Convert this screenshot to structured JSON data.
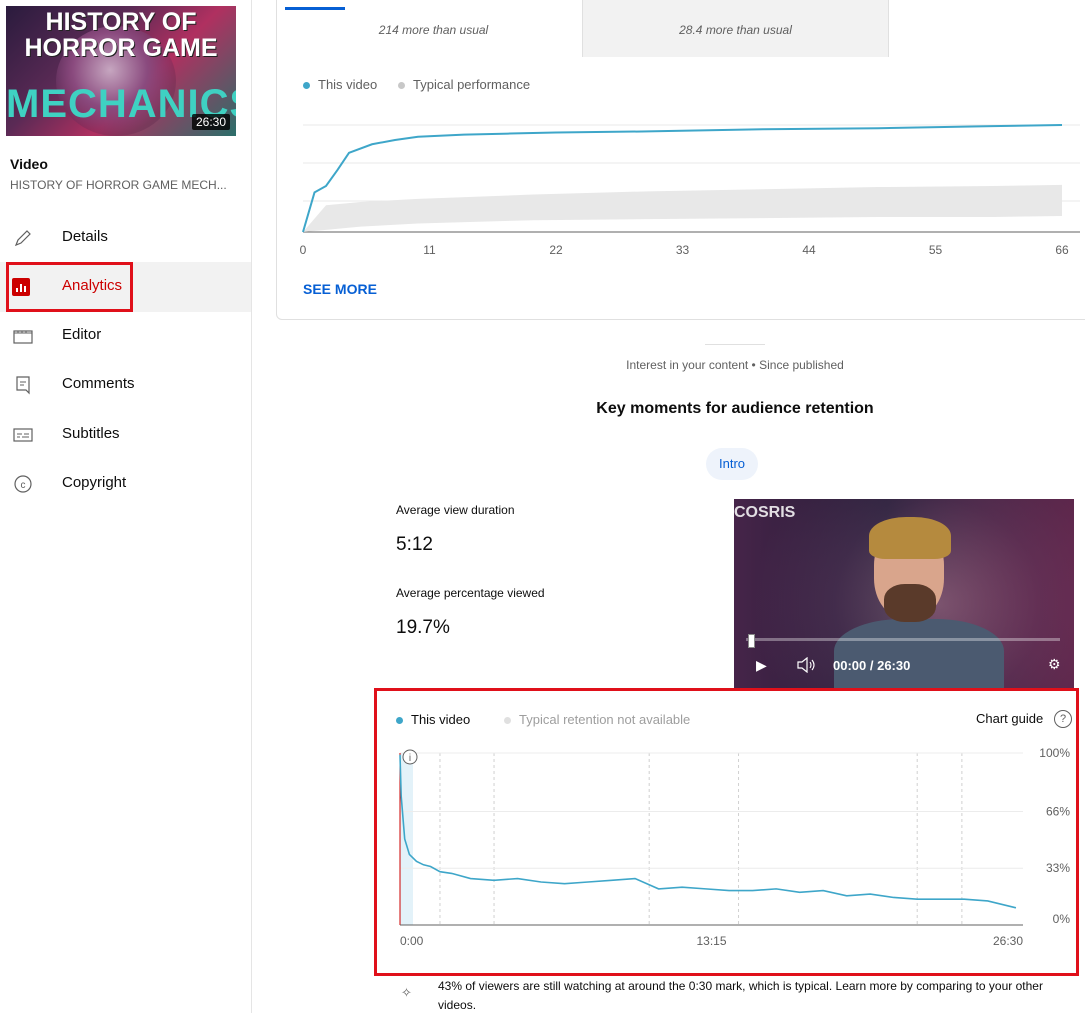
{
  "video": {
    "thumbnail_line1": "HISTORY OF",
    "thumbnail_line2": "HORROR GAME",
    "thumbnail_line3": "MECHANICS",
    "duration": "26:30",
    "section_label": "Video",
    "title": "HISTORY OF HORROR GAME MECH..."
  },
  "nav": [
    {
      "label": "Details",
      "icon": "pencil-icon"
    },
    {
      "label": "Analytics",
      "icon": "analytics-icon",
      "active": true
    },
    {
      "label": "Editor",
      "icon": "clapperboard-icon"
    },
    {
      "label": "Comments",
      "icon": "comment-icon"
    },
    {
      "label": "Subtitles",
      "icon": "subtitles-icon"
    },
    {
      "label": "Copyright",
      "icon": "copyright-icon"
    }
  ],
  "metric_tabs": [
    {
      "compare": "214 more than usual"
    },
    {
      "compare": "28.4 more than usual"
    },
    {
      "compare": ""
    }
  ],
  "views_chart": {
    "legend_this": "This video",
    "legend_typical": "Typical performance",
    "see_more": "SEE MORE"
  },
  "retention_section": {
    "subtitle": "Interest in your content • Since published",
    "title": "Key moments for audience retention",
    "chip": "Intro",
    "avg_view_duration_label": "Average view duration",
    "avg_view_duration": "5:12",
    "avg_pct_label": "Average percentage viewed",
    "avg_pct": "19.7%",
    "player_time": "00:00 / 26:30",
    "player_sign": "COSRIS",
    "legend_this": "This video",
    "legend_typical": "Typical retention not available",
    "chart_guide": "Chart guide",
    "insight": "43% of viewers are still watching at around the 0:30 mark, which is typical. Learn more by comparing to your other videos."
  },
  "colors": {
    "accent_blue": "#065fd4",
    "series": "#3ea6c9",
    "typical": "#e8e8e8",
    "active_red": "#cc0000",
    "highlight": "#e0101a"
  },
  "chart_data": [
    {
      "type": "line",
      "xlabel": "",
      "ylabel": "",
      "x_ticks": [
        "0",
        "11",
        "22",
        "33",
        "44",
        "55",
        "66"
      ],
      "series": [
        {
          "name": "This video",
          "x": [
            0,
            1,
            2,
            3,
            4,
            6,
            8,
            10,
            14,
            18,
            22,
            30,
            40,
            50,
            60,
            66
          ],
          "values": [
            0,
            37,
            43,
            58,
            74,
            82,
            86,
            89,
            91,
            92,
            93,
            94,
            96,
            97,
            99,
            100
          ]
        },
        {
          "name": "Typical performance",
          "x": [
            0,
            2,
            5,
            10,
            20,
            30,
            40,
            50,
            60,
            66
          ],
          "upper": [
            0,
            25,
            28,
            31,
            35,
            38,
            40,
            42,
            43,
            44
          ],
          "lower": [
            0,
            2,
            5,
            8,
            11,
            12,
            13,
            14,
            14,
            15
          ]
        }
      ],
      "ylim": [
        0,
        100
      ],
      "grid": true
    },
    {
      "type": "line",
      "xlabel": "",
      "ylabel": "",
      "x_ticks": [
        "0:00",
        "13:15",
        "26:30"
      ],
      "y_ticks": [
        "100%",
        "66%",
        "33%",
        "0%"
      ],
      "xlim": [
        0,
        26.5
      ],
      "ylim": [
        0,
        100
      ],
      "series": [
        {
          "name": "This video",
          "x": [
            0,
            0.05,
            0.2,
            0.4,
            0.7,
            1,
            1.3,
            1.7,
            2.2,
            3,
            4,
            5,
            6,
            7,
            8,
            9,
            10,
            11,
            12,
            13,
            14,
            15,
            16,
            17,
            18,
            19,
            20,
            21,
            22,
            23,
            24,
            25,
            26.2
          ],
          "values": [
            99,
            75,
            50,
            41,
            37,
            35,
            34,
            31,
            30,
            27,
            26,
            27,
            25,
            24,
            25,
            26,
            27,
            21,
            22,
            21,
            20,
            20,
            21,
            19,
            20,
            17,
            18,
            16,
            15,
            15,
            15,
            14,
            10
          ]
        }
      ],
      "grid": true,
      "legend": "top-left"
    }
  ]
}
